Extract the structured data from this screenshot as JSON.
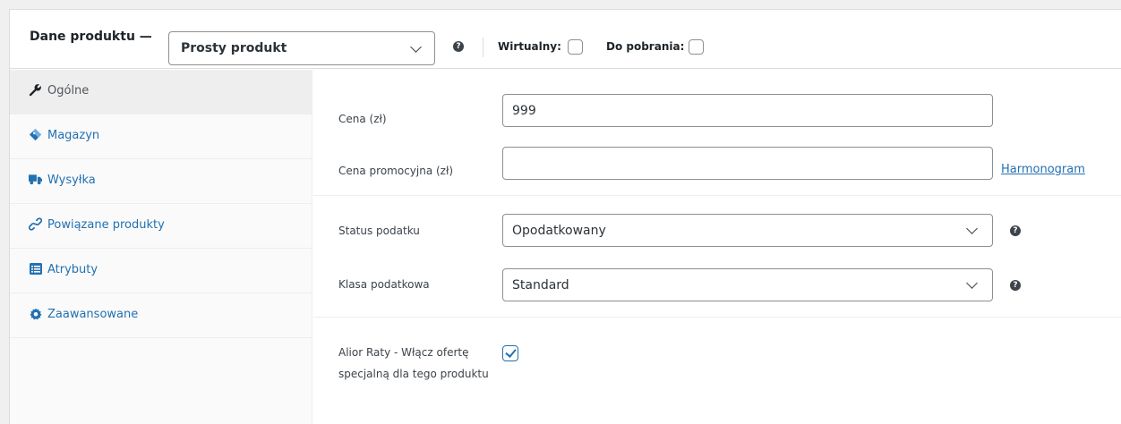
{
  "header": {
    "title": "Dane produktu —",
    "product_type": "Prosty produkt",
    "virtual_label": "Wirtualny:",
    "downloadable_label": "Do pobrania:",
    "help_glyph": "?"
  },
  "sidebar": {
    "items": [
      {
        "label": "Ogólne",
        "icon": "wrench-icon",
        "active": true
      },
      {
        "label": "Magazyn",
        "icon": "tag-icon",
        "active": false
      },
      {
        "label": "Wysyłka",
        "icon": "truck-icon",
        "active": false
      },
      {
        "label": "Powiązane produkty",
        "icon": "link-icon",
        "active": false
      },
      {
        "label": "Atrybuty",
        "icon": "list-icon",
        "active": false
      },
      {
        "label": "Zaawansowane",
        "icon": "gear-icon",
        "active": false
      }
    ]
  },
  "general": {
    "price_label": "Cena (zł)",
    "price_value": "999",
    "sale_price_label": "Cena promocyjna (zł)",
    "sale_price_value": "",
    "schedule_link": "Harmonogram",
    "tax_status_label": "Status podatku",
    "tax_status_value": "Opodatkowany",
    "tax_class_label": "Klasa podatkowa",
    "tax_class_value": "Standard",
    "alior_label": "Alior Raty - Włącz ofertę specjalną dla tego produktu",
    "alior_checked": true
  },
  "colors": {
    "link": "#2271b1",
    "icon_dark": "#3c434a",
    "active_tab_bg": "#eeeeee"
  }
}
